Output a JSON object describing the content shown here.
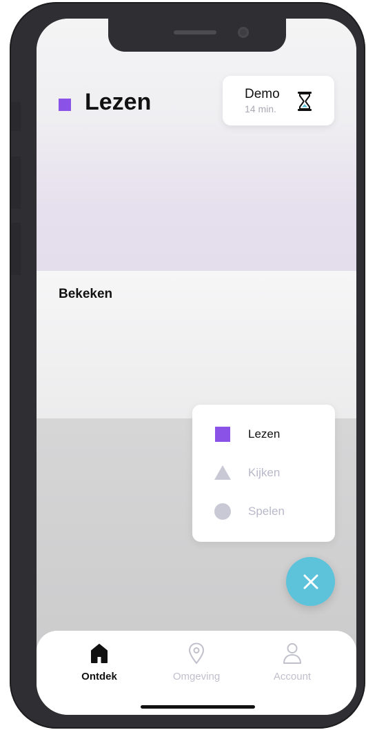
{
  "header": {
    "title": "Lezen",
    "demo_label": "Demo",
    "demo_time": "14 min."
  },
  "section": {
    "title": "Bekeken"
  },
  "filter_menu": {
    "items": [
      {
        "label": "Lezen",
        "icon": "square-icon",
        "active": true
      },
      {
        "label": "Kijken",
        "icon": "triangle-icon",
        "active": false
      },
      {
        "label": "Spelen",
        "icon": "circle-icon",
        "active": false
      }
    ]
  },
  "fab": {
    "icon": "close-icon"
  },
  "tabbar": {
    "items": [
      {
        "label": "Ontdek",
        "icon": "home-icon",
        "active": true
      },
      {
        "label": "Omgeving",
        "icon": "location-pin-icon",
        "active": false
      },
      {
        "label": "Account",
        "icon": "user-icon",
        "active": false
      }
    ]
  },
  "colors": {
    "accent_purple": "#8b52e8",
    "fab_teal": "#5cc3da",
    "inactive_grey": "#c0c0cc",
    "phone_frame": "#2f2f33"
  }
}
